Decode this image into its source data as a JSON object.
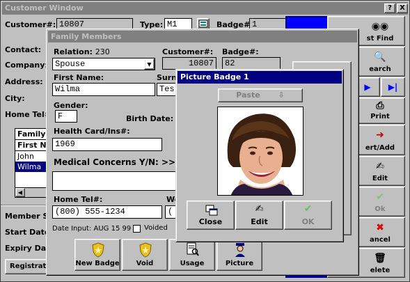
{
  "customer_window": {
    "title": "Customer Window",
    "help_btn": "?",
    "close_btn": "X",
    "customer_label": "Customer#:",
    "customer_value": "10807",
    "type_label": "Type:",
    "type_value": "M1",
    "badge_label": "Badge#:",
    "badge_value": "1",
    "contact_label": "Contact:",
    "company_label": "Company:",
    "address_label": "Address:",
    "city_label": "City:",
    "home_tel_label": "Home Tel#",
    "family_header": "Family",
    "first_name_header": "First Na",
    "family_list": [
      "John",
      "Wilma"
    ],
    "member_label": "Member S",
    "start_date_label": "Start Date",
    "expiry_label": "Expiry Da",
    "register_button": "Registrat"
  },
  "right_toolbar": {
    "first_find": "st Find",
    "search": "earch",
    "prev_arrow": "▶",
    "last_arrow": "▶|",
    "print": "Print",
    "insert": "ert/Add",
    "edit": "Edit",
    "ok": "Ok",
    "cancel": "ancel",
    "delete": "elete"
  },
  "family_window": {
    "title": "Family Members",
    "relation_label": "Relation:",
    "relation_number": "230",
    "relation_value": "Spouse",
    "customer_label": "Customer#:",
    "customer_value": "10807",
    "badge_label": "Badge#:",
    "badge_value": "82",
    "first_name_label": "First Name:",
    "first_name_value": "Wilma",
    "surname_label": "Surn",
    "surname_value": "Tes",
    "gender_label": "Gender:",
    "gender_value": "F",
    "birth_date_label": "Birth Date:",
    "health_label": "Health Card/Ins#:",
    "health_value": "1969",
    "medical_label": "Medical Concerns Y/N: >>",
    "home_tel_label": "Home Tel#:",
    "home_tel_value": "(800) 555-1234",
    "work_label": "Wo",
    "work_value": "(",
    "date_input_label": "Date Input: AUG 15 99",
    "voided_label": "Voided",
    "buttons": {
      "new_badge": "New Badge",
      "void": "Void",
      "usage": "Usage",
      "picture": "Picture"
    }
  },
  "badge_dialog": {
    "title": "Picture Badge 1",
    "paste_label": "Paste",
    "close_label": "Close",
    "edit_label": "Edit",
    "ok_label": "OK"
  }
}
